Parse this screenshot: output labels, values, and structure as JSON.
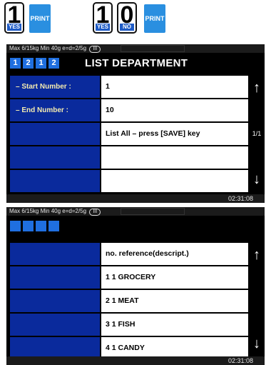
{
  "keys": {
    "k1_digit": "1",
    "k1_sub": "YES",
    "print1": "PRINT",
    "k2_digit": "1",
    "k2_sub": "YES",
    "k3_digit": "0",
    "k3_sub": "NO",
    "print2": "PRINT"
  },
  "screen1": {
    "status": "Max 6/15kg Min 40g e=d=2/5g",
    "range": "III",
    "cells": [
      "1",
      "2",
      "1",
      "2"
    ],
    "title": "LIST DEPARTMENT",
    "rows": [
      {
        "label": "– Start Number :",
        "value": "1"
      },
      {
        "label": "– End Number  :",
        "value": "10"
      },
      {
        "label": "",
        "value": "List All – press [SAVE] key"
      },
      {
        "label": "",
        "value": ""
      },
      {
        "label": "",
        "value": ""
      }
    ],
    "page": "1/1",
    "time": "02:31:08"
  },
  "screen2": {
    "status": "Max 6/15kg Min 40g e=d=2/5g",
    "range": "III",
    "cells": [
      "",
      "",
      "",
      ""
    ],
    "rows": [
      {
        "label": "",
        "value": "no. reference(descript.)"
      },
      {
        "label": "",
        "value": "1 1 GROCERY"
      },
      {
        "label": "",
        "value": "2 1 MEAT"
      },
      {
        "label": "",
        "value": "3 1 FISH"
      },
      {
        "label": "",
        "value": "4 1 CANDY"
      }
    ],
    "time": "02:31:08"
  },
  "icons": {
    "up": "arrow-up-icon",
    "down": "arrow-down-icon"
  },
  "colors": {
    "label_bg": "#0A2A9C",
    "accent": "#1F6FE0",
    "print_key": "#2A8FE0"
  }
}
